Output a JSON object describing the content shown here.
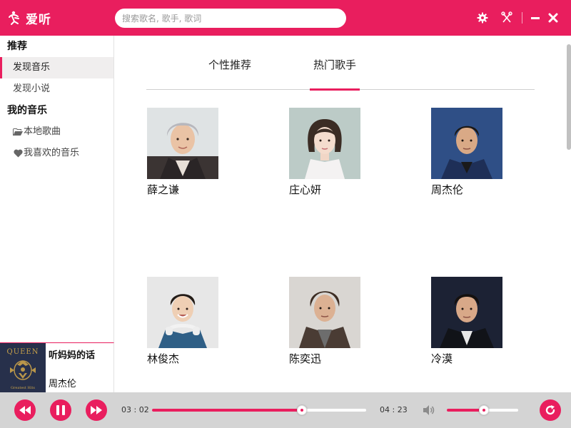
{
  "app": {
    "name": "爱听",
    "accent": "#e91e5e"
  },
  "search": {
    "placeholder": "搜索歌名, 歌手, 歌词",
    "value": ""
  },
  "window_controls": [
    "settings-icon",
    "skin-icon",
    "minimize-icon",
    "close-icon"
  ],
  "sidebar": {
    "section_recommend": "推荐",
    "items_recommend": [
      {
        "label": "发现音乐",
        "active": true
      },
      {
        "label": "发现小说",
        "active": false
      }
    ],
    "section_mymusic": "我的音乐",
    "items_mymusic": [
      {
        "label": "本地歌曲",
        "icon": "folder-open-icon"
      },
      {
        "label": "我喜欢的音乐",
        "icon": "heart-icon"
      }
    ]
  },
  "now_playing": {
    "title": "听妈妈的话",
    "artist": "周杰伦",
    "cover_text": "QUEEN",
    "cover_subtext": "Greatest Hits"
  },
  "main": {
    "tabs": [
      {
        "label": "个性推荐",
        "active": false
      },
      {
        "label": "热门歌手",
        "active": true
      }
    ],
    "artists": [
      {
        "name": "薛之谦"
      },
      {
        "name": "庄心妍"
      },
      {
        "name": "周杰伦"
      },
      {
        "name": "林俊杰"
      },
      {
        "name": "陈奕迅"
      },
      {
        "name": "冷漠"
      }
    ]
  },
  "player": {
    "current_time": "03 : 02",
    "total_time": "04 : 23",
    "progress": 0.7,
    "volume": 0.52
  }
}
